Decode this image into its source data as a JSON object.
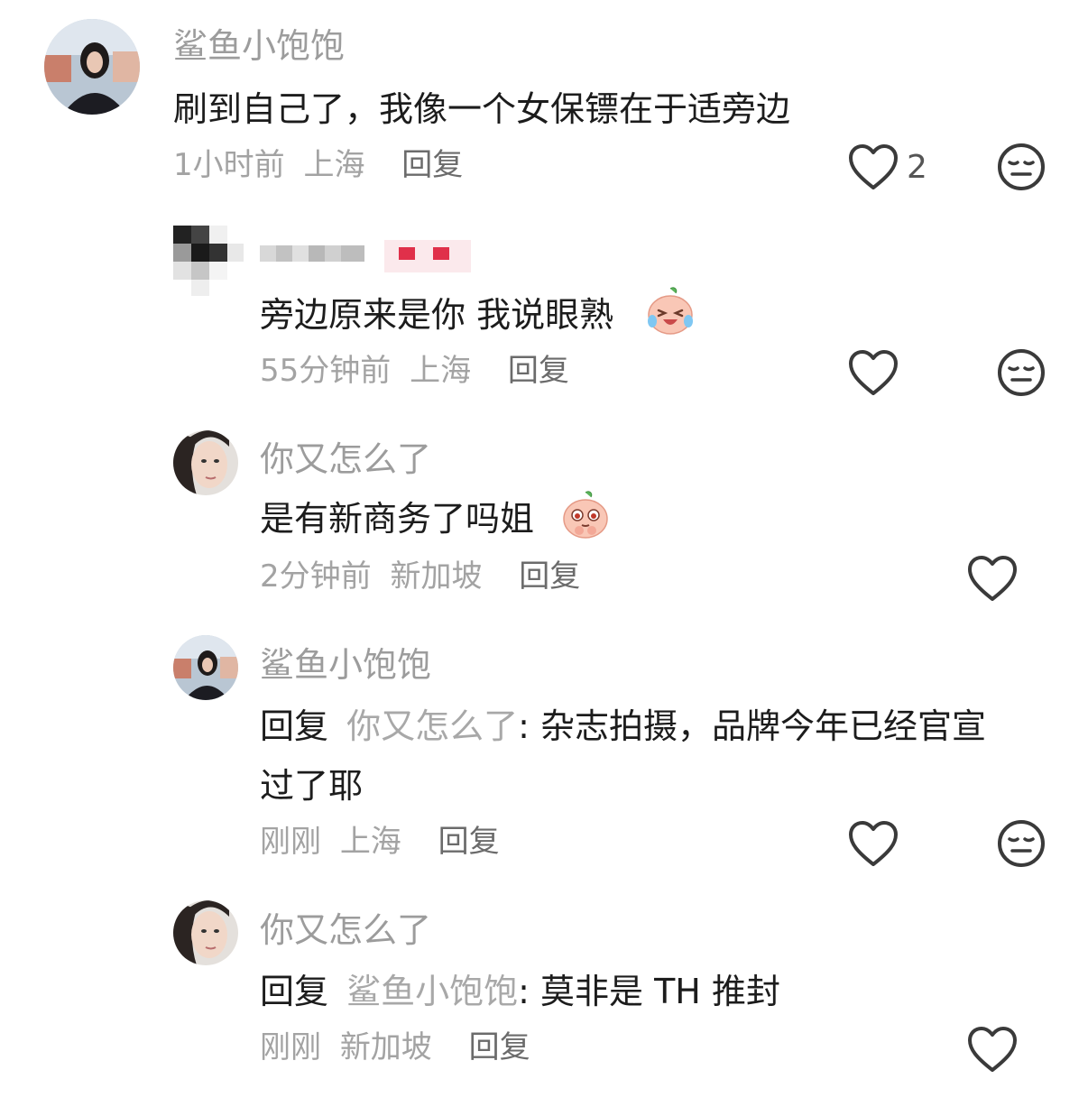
{
  "comments": [
    {
      "username": "鲨鱼小饱饱",
      "text": "刷到自己了，我像一个女保镖在于适旁边",
      "time": "1小时前",
      "location": "上海",
      "reply_label": "回复",
      "likes": "2"
    },
    {
      "username": "",
      "text": "旁边原来是你 我说眼熟",
      "time": "55分钟前",
      "location": "上海",
      "reply_label": "回复"
    },
    {
      "username": "你又怎么了",
      "text": "是有新商务了吗姐",
      "time": "2分钟前",
      "location": "新加坡",
      "reply_label": "回复"
    },
    {
      "username": "鲨鱼小饱饱",
      "reply_prefix": "回复",
      "reply_to": "你又怎么了",
      "text_line1": ": 杂志拍摄，品牌今年已经官宣",
      "text_line2": "过了耶",
      "time": "刚刚",
      "location": "上海",
      "reply_label": "回复"
    },
    {
      "username": "你又怎么了",
      "reply_prefix": "回复",
      "reply_to": "鲨鱼小饱饱",
      "text": ": 莫非是 TH 推封",
      "time": "刚刚",
      "location": "新加坡",
      "reply_label": "回复"
    }
  ],
  "colors": {
    "username": "#9c9c9c",
    "body": "#1c1c1c",
    "meta": "#a3a3a3",
    "reply_button": "#6b6b6b",
    "icon": "#3a3a3a"
  },
  "icons": {
    "like": "heart-outline-icon",
    "dislike": "neutral-face-icon",
    "emoji_laugh": "laughing-peach-emoji",
    "emoji_plead": "pleading-peach-emoji"
  }
}
